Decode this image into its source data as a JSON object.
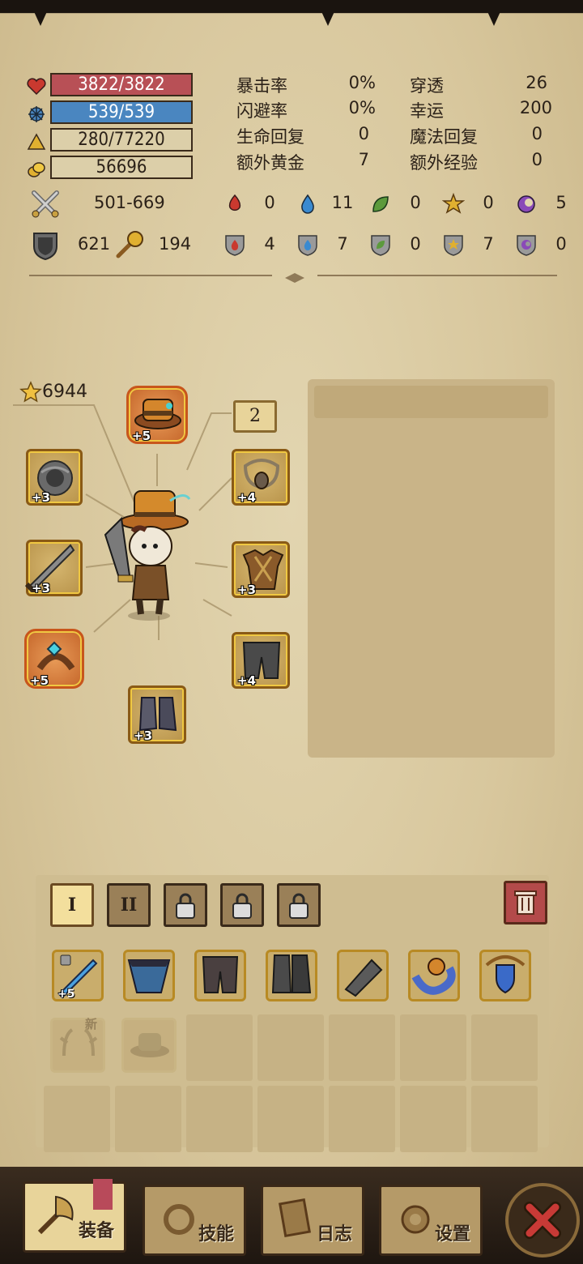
{
  "resources": {
    "hp": "3822/3822",
    "mp": "539/539",
    "xp": "280/77220",
    "gold": "56696"
  },
  "stats": [
    {
      "label": "暴击率",
      "value": "0%"
    },
    {
      "label": "闪避率",
      "value": "0%"
    },
    {
      "label": "生命回复",
      "value": "0"
    },
    {
      "label": "额外黄金",
      "value": "7"
    },
    {
      "label": "穿透",
      "value": "26"
    },
    {
      "label": "幸运",
      "value": "200"
    },
    {
      "label": "魔法回复",
      "value": "0"
    },
    {
      "label": "额外经验",
      "value": "0"
    }
  ],
  "attack": "501-669",
  "defense": "621",
  "magic_power": "194",
  "elem_attack": [
    "0",
    "11",
    "0",
    "0",
    "5"
  ],
  "elem_resist": [
    "4",
    "7",
    "0",
    "7",
    "0"
  ],
  "power_score": "6944",
  "badge_count": "2",
  "equipment": {
    "helmet": "+5",
    "necklace": "+3",
    "weapon": "+3",
    "ring": "+5",
    "boots": "+3",
    "amulet": "+4",
    "armor": "+3",
    "pants": "+4"
  },
  "bag_tabs": [
    "I",
    "II"
  ],
  "inventory": [
    {
      "level": "+5"
    }
  ],
  "new_label": "新",
  "nav": {
    "equip": "装备",
    "skills": "技能",
    "log": "日志",
    "settings": "设置"
  },
  "colors": {
    "hp": "#b85056",
    "mp": "#4a86c0",
    "fire": "#c9392f",
    "water": "#3a8ad0",
    "nature": "#5c9a3c",
    "light": "#e0b030",
    "arcane": "#8a4ab8",
    "close": "#c83a36"
  }
}
